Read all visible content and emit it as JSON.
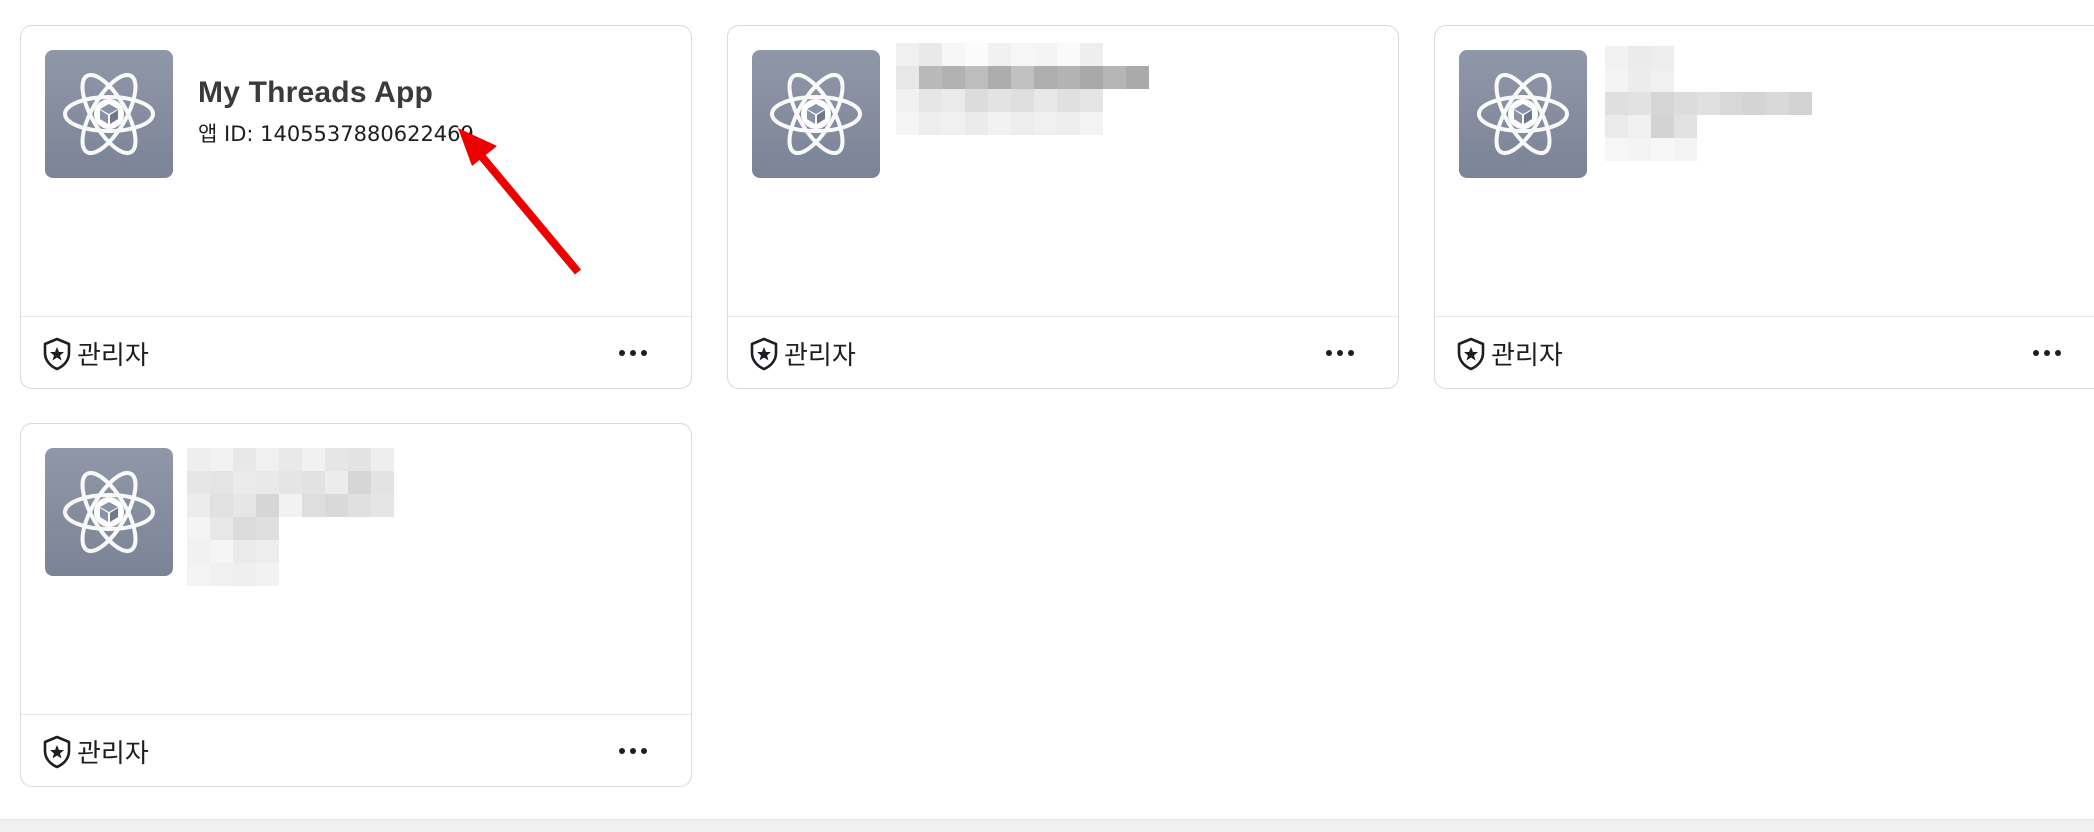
{
  "cards": [
    {
      "name": "My Threads App",
      "app_id": "앱 ID: 1405537880622469",
      "role": "관리자",
      "more": "•••"
    },
    {
      "name": "",
      "app_id": "",
      "role": "관리자",
      "more": "•••"
    },
    {
      "name": "",
      "app_id": "",
      "role": "관리자",
      "more": "•••"
    },
    {
      "name": "",
      "app_id": "",
      "role": "관리자",
      "more": "•••"
    }
  ],
  "icons": {
    "app": "atom-cube-icon",
    "role": "shield-star-icon",
    "more": "more-horizontal-icon",
    "annotation": "red-arrow-annotation"
  },
  "colors": {
    "app_icon_bg": "#838b9e",
    "arrow": "#ee0000",
    "card_border": "#d8dadf",
    "text": "#1c1e21"
  }
}
